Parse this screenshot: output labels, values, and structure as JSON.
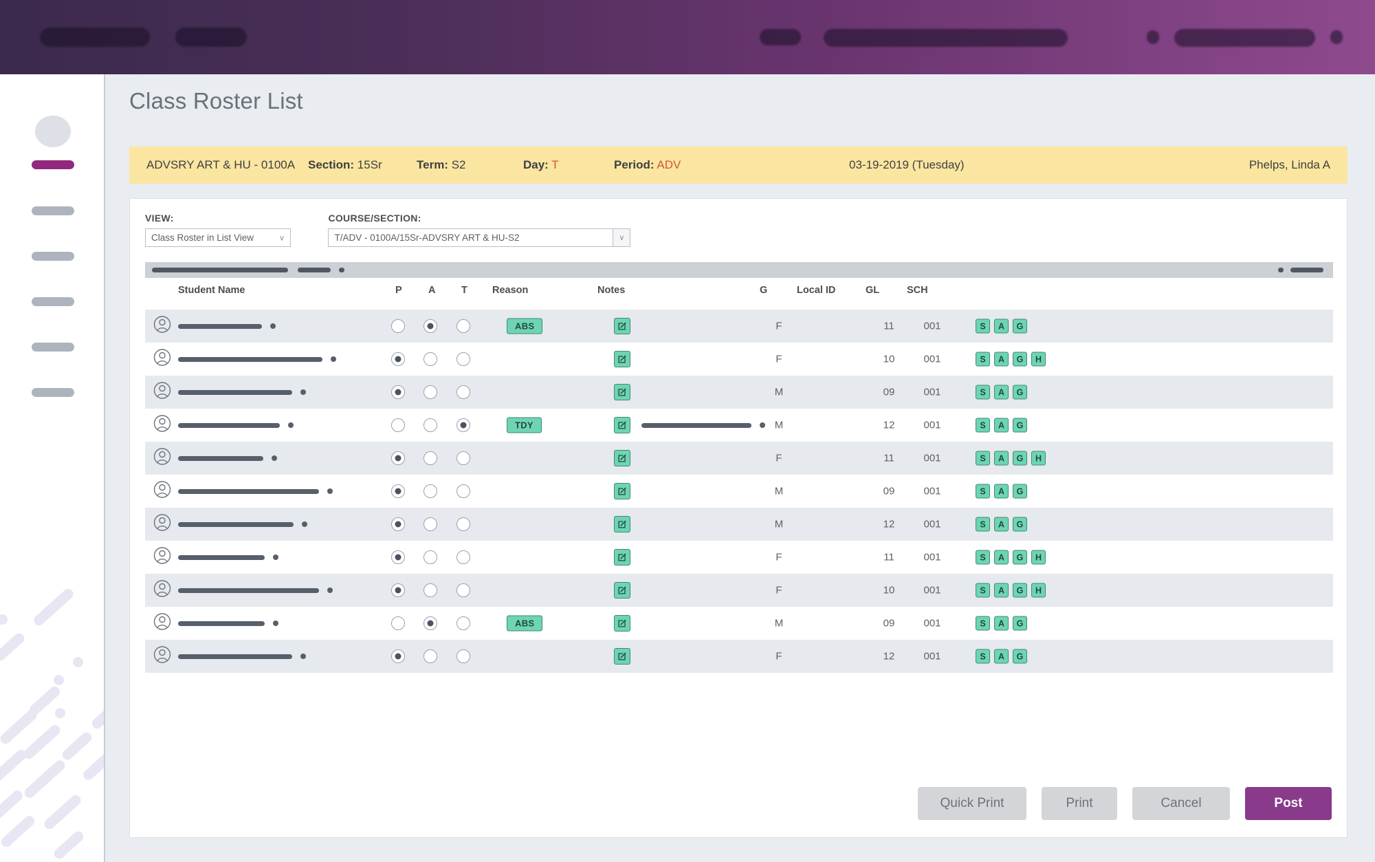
{
  "topbar": {
    "blobs_label": "redacted-topbar-items"
  },
  "sidebar": {
    "avatar_label": "user-avatar-placeholder",
    "items": [
      {
        "label": "",
        "active": true
      },
      {
        "label": "",
        "active": false
      },
      {
        "label": "",
        "active": false
      },
      {
        "label": "",
        "active": false
      },
      {
        "label": "",
        "active": false
      },
      {
        "label": "",
        "active": false
      }
    ]
  },
  "page": {
    "title": "Class Roster List"
  },
  "banner": {
    "course": "ADVSRY ART & HU - 0100A",
    "section_label": "Section:",
    "section_value": "15Sr",
    "term_label": "Term:",
    "term_value": "S2",
    "day_label": "Day:",
    "day_value": "T",
    "period_label": "Period:",
    "period_value": "ADV",
    "date": "03-19-2019 (Tuesday)",
    "teacher": "Phelps, Linda A"
  },
  "filters": {
    "view_label": "VIEW:",
    "view_value": "Class Roster in List View",
    "course_label": "COURSE/SECTION:",
    "course_value": "T/ADV - 0100A/15Sr-ADVSRY ART & HU-S2",
    "chevron": "∨"
  },
  "table": {
    "columns": [
      "Student Name",
      "P",
      "A",
      "T",
      "Reason",
      "Notes",
      "G",
      "Local ID",
      "GL",
      "SCH"
    ],
    "rows": [
      {
        "name_w": 122,
        "attendance": "A",
        "reason": "ABS",
        "note": "",
        "note_w": 0,
        "g": "F",
        "gl": "11",
        "sch": "001",
        "badges": [
          "S",
          "A",
          "G"
        ]
      },
      {
        "name_w": 210,
        "attendance": "P",
        "reason": "",
        "note": "",
        "note_w": 0,
        "g": "F",
        "gl": "10",
        "sch": "001",
        "badges": [
          "S",
          "A",
          "G",
          "H"
        ]
      },
      {
        "name_w": 166,
        "attendance": "P",
        "reason": "",
        "note": "",
        "note_w": 0,
        "g": "M",
        "gl": "09",
        "sch": "001",
        "badges": [
          "S",
          "A",
          "G"
        ]
      },
      {
        "name_w": 148,
        "attendance": "T",
        "reason": "TDY",
        "note": "redacted-note",
        "note_w": 160,
        "g": "M",
        "gl": "12",
        "sch": "001",
        "badges": [
          "S",
          "A",
          "G"
        ]
      },
      {
        "name_w": 124,
        "attendance": "P",
        "reason": "",
        "note": "",
        "note_w": 0,
        "g": "F",
        "gl": "11",
        "sch": "001",
        "badges": [
          "S",
          "A",
          "G",
          "H"
        ]
      },
      {
        "name_w": 205,
        "attendance": "P",
        "reason": "",
        "note": "",
        "note_w": 0,
        "g": "M",
        "gl": "09",
        "sch": "001",
        "badges": [
          "S",
          "A",
          "G"
        ]
      },
      {
        "name_w": 168,
        "attendance": "P",
        "reason": "",
        "note": "",
        "note_w": 0,
        "g": "M",
        "gl": "12",
        "sch": "001",
        "badges": [
          "S",
          "A",
          "G"
        ]
      },
      {
        "name_w": 126,
        "attendance": "P",
        "reason": "",
        "note": "",
        "note_w": 0,
        "g": "F",
        "gl": "11",
        "sch": "001",
        "badges": [
          "S",
          "A",
          "G",
          "H"
        ]
      },
      {
        "name_w": 205,
        "attendance": "P",
        "reason": "",
        "note": "",
        "note_w": 0,
        "g": "F",
        "gl": "10",
        "sch": "001",
        "badges": [
          "S",
          "A",
          "G",
          "H"
        ]
      },
      {
        "name_w": 126,
        "attendance": "A",
        "reason": "ABS",
        "note": "",
        "note_w": 0,
        "g": "M",
        "gl": "09",
        "sch": "001",
        "badges": [
          "S",
          "A",
          "G"
        ]
      },
      {
        "name_w": 166,
        "attendance": "P",
        "reason": "",
        "note": "",
        "note_w": 0,
        "g": "F",
        "gl": "12",
        "sch": "001",
        "badges": [
          "S",
          "A",
          "G"
        ]
      }
    ]
  },
  "actions": {
    "quick_print": "Quick Print",
    "print": "Print",
    "cancel": "Cancel",
    "post": "Post"
  },
  "colors": {
    "brand_purple": "#8a3a8a",
    "banner_yellow": "#fae6a0",
    "teal_badge": "#6ed4b4",
    "accent_red": "#d4533a",
    "row_alt": "#e6e9ee"
  }
}
